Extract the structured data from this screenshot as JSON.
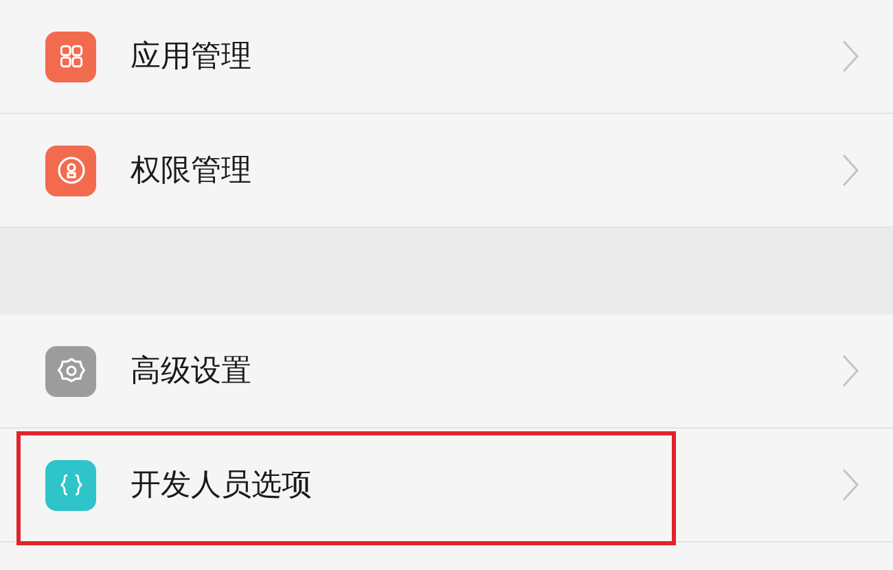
{
  "sections": [
    {
      "items": [
        {
          "kind": "apps",
          "label": "应用管理",
          "highlighted": false
        },
        {
          "kind": "permissions",
          "label": "权限管理",
          "highlighted": false
        }
      ]
    },
    {
      "items": [
        {
          "kind": "advanced",
          "label": "高级设置",
          "highlighted": false
        },
        {
          "kind": "developer",
          "label": "开发人员选项",
          "highlighted": true
        }
      ]
    }
  ]
}
